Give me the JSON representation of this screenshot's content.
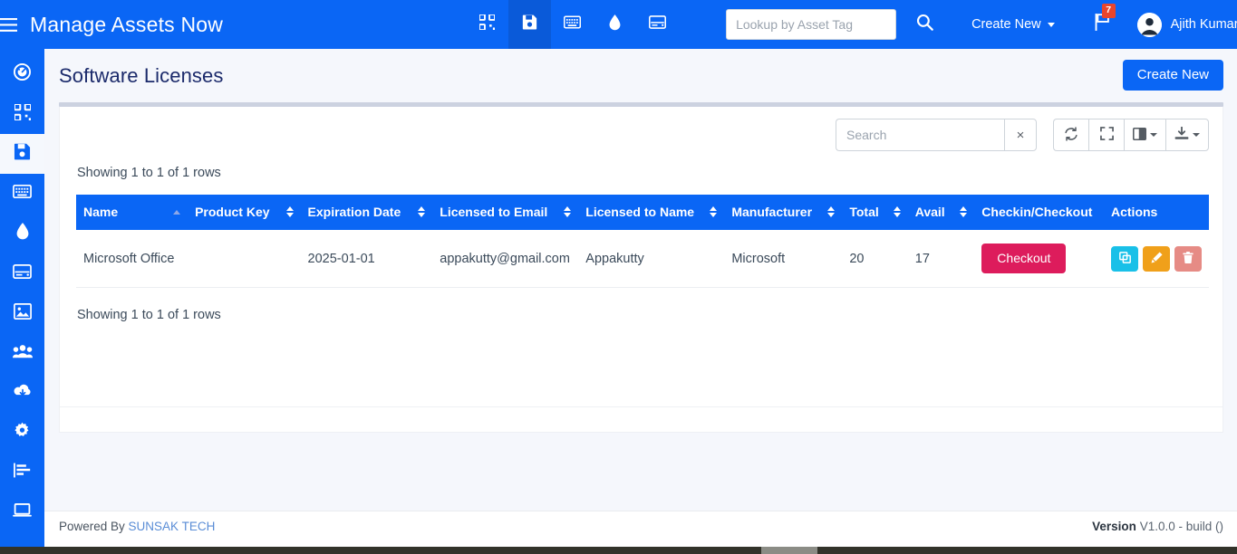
{
  "topbar": {
    "menu_icon": "hamburger-icon",
    "brand": "Manage Assets Now",
    "nav_icons": [
      {
        "name": "qrcode-icon",
        "active": false
      },
      {
        "name": "floppy-save-icon",
        "active": true
      },
      {
        "name": "keyboard-icon",
        "active": false
      },
      {
        "name": "water-drop-icon",
        "active": false
      },
      {
        "name": "hard-drive-icon",
        "active": false
      }
    ],
    "lookup_placeholder": "Lookup by Asset Tag",
    "lookup_value": "",
    "search_icon": "search-icon",
    "create_new_label": "Create New",
    "flag_icon": "flag-icon",
    "flag_badge": "7",
    "user_name": "Ajith Kumar",
    "settings_icon": "cogs-icon"
  },
  "sidebar": {
    "items": [
      {
        "name": "sidebar-item-dashboard",
        "icon": "speedometer-icon",
        "active": false
      },
      {
        "name": "sidebar-item-qrcode",
        "icon": "qrcode-icon",
        "active": false
      },
      {
        "name": "sidebar-item-licenses",
        "icon": "floppy-save-icon",
        "active": true
      },
      {
        "name": "sidebar-item-accessories",
        "icon": "keyboard-icon",
        "active": false
      },
      {
        "name": "sidebar-item-consumables",
        "icon": "water-drop-icon",
        "active": false
      },
      {
        "name": "sidebar-item-components",
        "icon": "hard-drive-icon",
        "active": false
      },
      {
        "name": "sidebar-item-images",
        "icon": "image-icon",
        "active": false
      },
      {
        "name": "sidebar-item-users",
        "icon": "users-icon",
        "active": false
      },
      {
        "name": "sidebar-item-import",
        "icon": "cloud-download-icon",
        "active": false
      },
      {
        "name": "sidebar-item-settings",
        "icon": "gear-icon",
        "active": false
      },
      {
        "name": "sidebar-item-reports",
        "icon": "bar-chart-icon",
        "active": false
      },
      {
        "name": "sidebar-item-assets",
        "icon": "laptop-icon",
        "active": false
      }
    ]
  },
  "page": {
    "title": "Software Licenses",
    "create_new_label": "Create New"
  },
  "toolbar": {
    "search_placeholder": "Search",
    "search_value": "",
    "clear_label": "×",
    "refresh_icon": "refresh-icon",
    "fullscreen_icon": "fullscreen-icon",
    "columns_icon": "columns-icon",
    "export_icon": "export-download-icon"
  },
  "table": {
    "rows_info_top": "Showing 1 to 1 of 1 rows",
    "rows_info_bottom": "Showing 1 to 1 of 1 rows",
    "columns": [
      {
        "label": "Name",
        "sort": "asc"
      },
      {
        "label": "Product Key",
        "sort": "both"
      },
      {
        "label": "Expiration Date",
        "sort": "both"
      },
      {
        "label": "Licensed to Email",
        "sort": "both"
      },
      {
        "label": "Licensed to Name",
        "sort": "both"
      },
      {
        "label": "Manufacturer",
        "sort": "both"
      },
      {
        "label": "Total",
        "sort": "both"
      },
      {
        "label": "Avail",
        "sort": "both"
      },
      {
        "label": "Checkin/Checkout",
        "sort": "none"
      },
      {
        "label": "Actions",
        "sort": "none"
      }
    ],
    "rows": [
      {
        "name": "Microsoft Office",
        "product_key": "",
        "expiration_date": "2025-01-01",
        "licensed_to_email": "appakutty@gmail.com",
        "licensed_to_name": "Appakutty",
        "manufacturer": "Microsoft",
        "total": "20",
        "avail": "17",
        "checkout_label": "Checkout",
        "actions": [
          {
            "name": "clone-button",
            "icon": "copy-icon",
            "color": "#19c0e8"
          },
          {
            "name": "edit-button",
            "icon": "pencil-icon",
            "color": "#f0a01a"
          },
          {
            "name": "delete-button",
            "icon": "trash-icon",
            "color": "#e68b85"
          }
        ]
      }
    ]
  },
  "footer": {
    "powered_prefix": "Powered By ",
    "powered_link": "SUNSAK TECH",
    "version_label": "Version",
    "version_value": "V1.0.0 - build ()"
  },
  "colors": {
    "brand_blue": "#0a66f5",
    "active_nav": "#0a5ad9",
    "page_bg": "#f5f7fc",
    "title": "#1b2a6b",
    "checkout": "#dd1c5c",
    "badge_red": "#e8452c"
  }
}
